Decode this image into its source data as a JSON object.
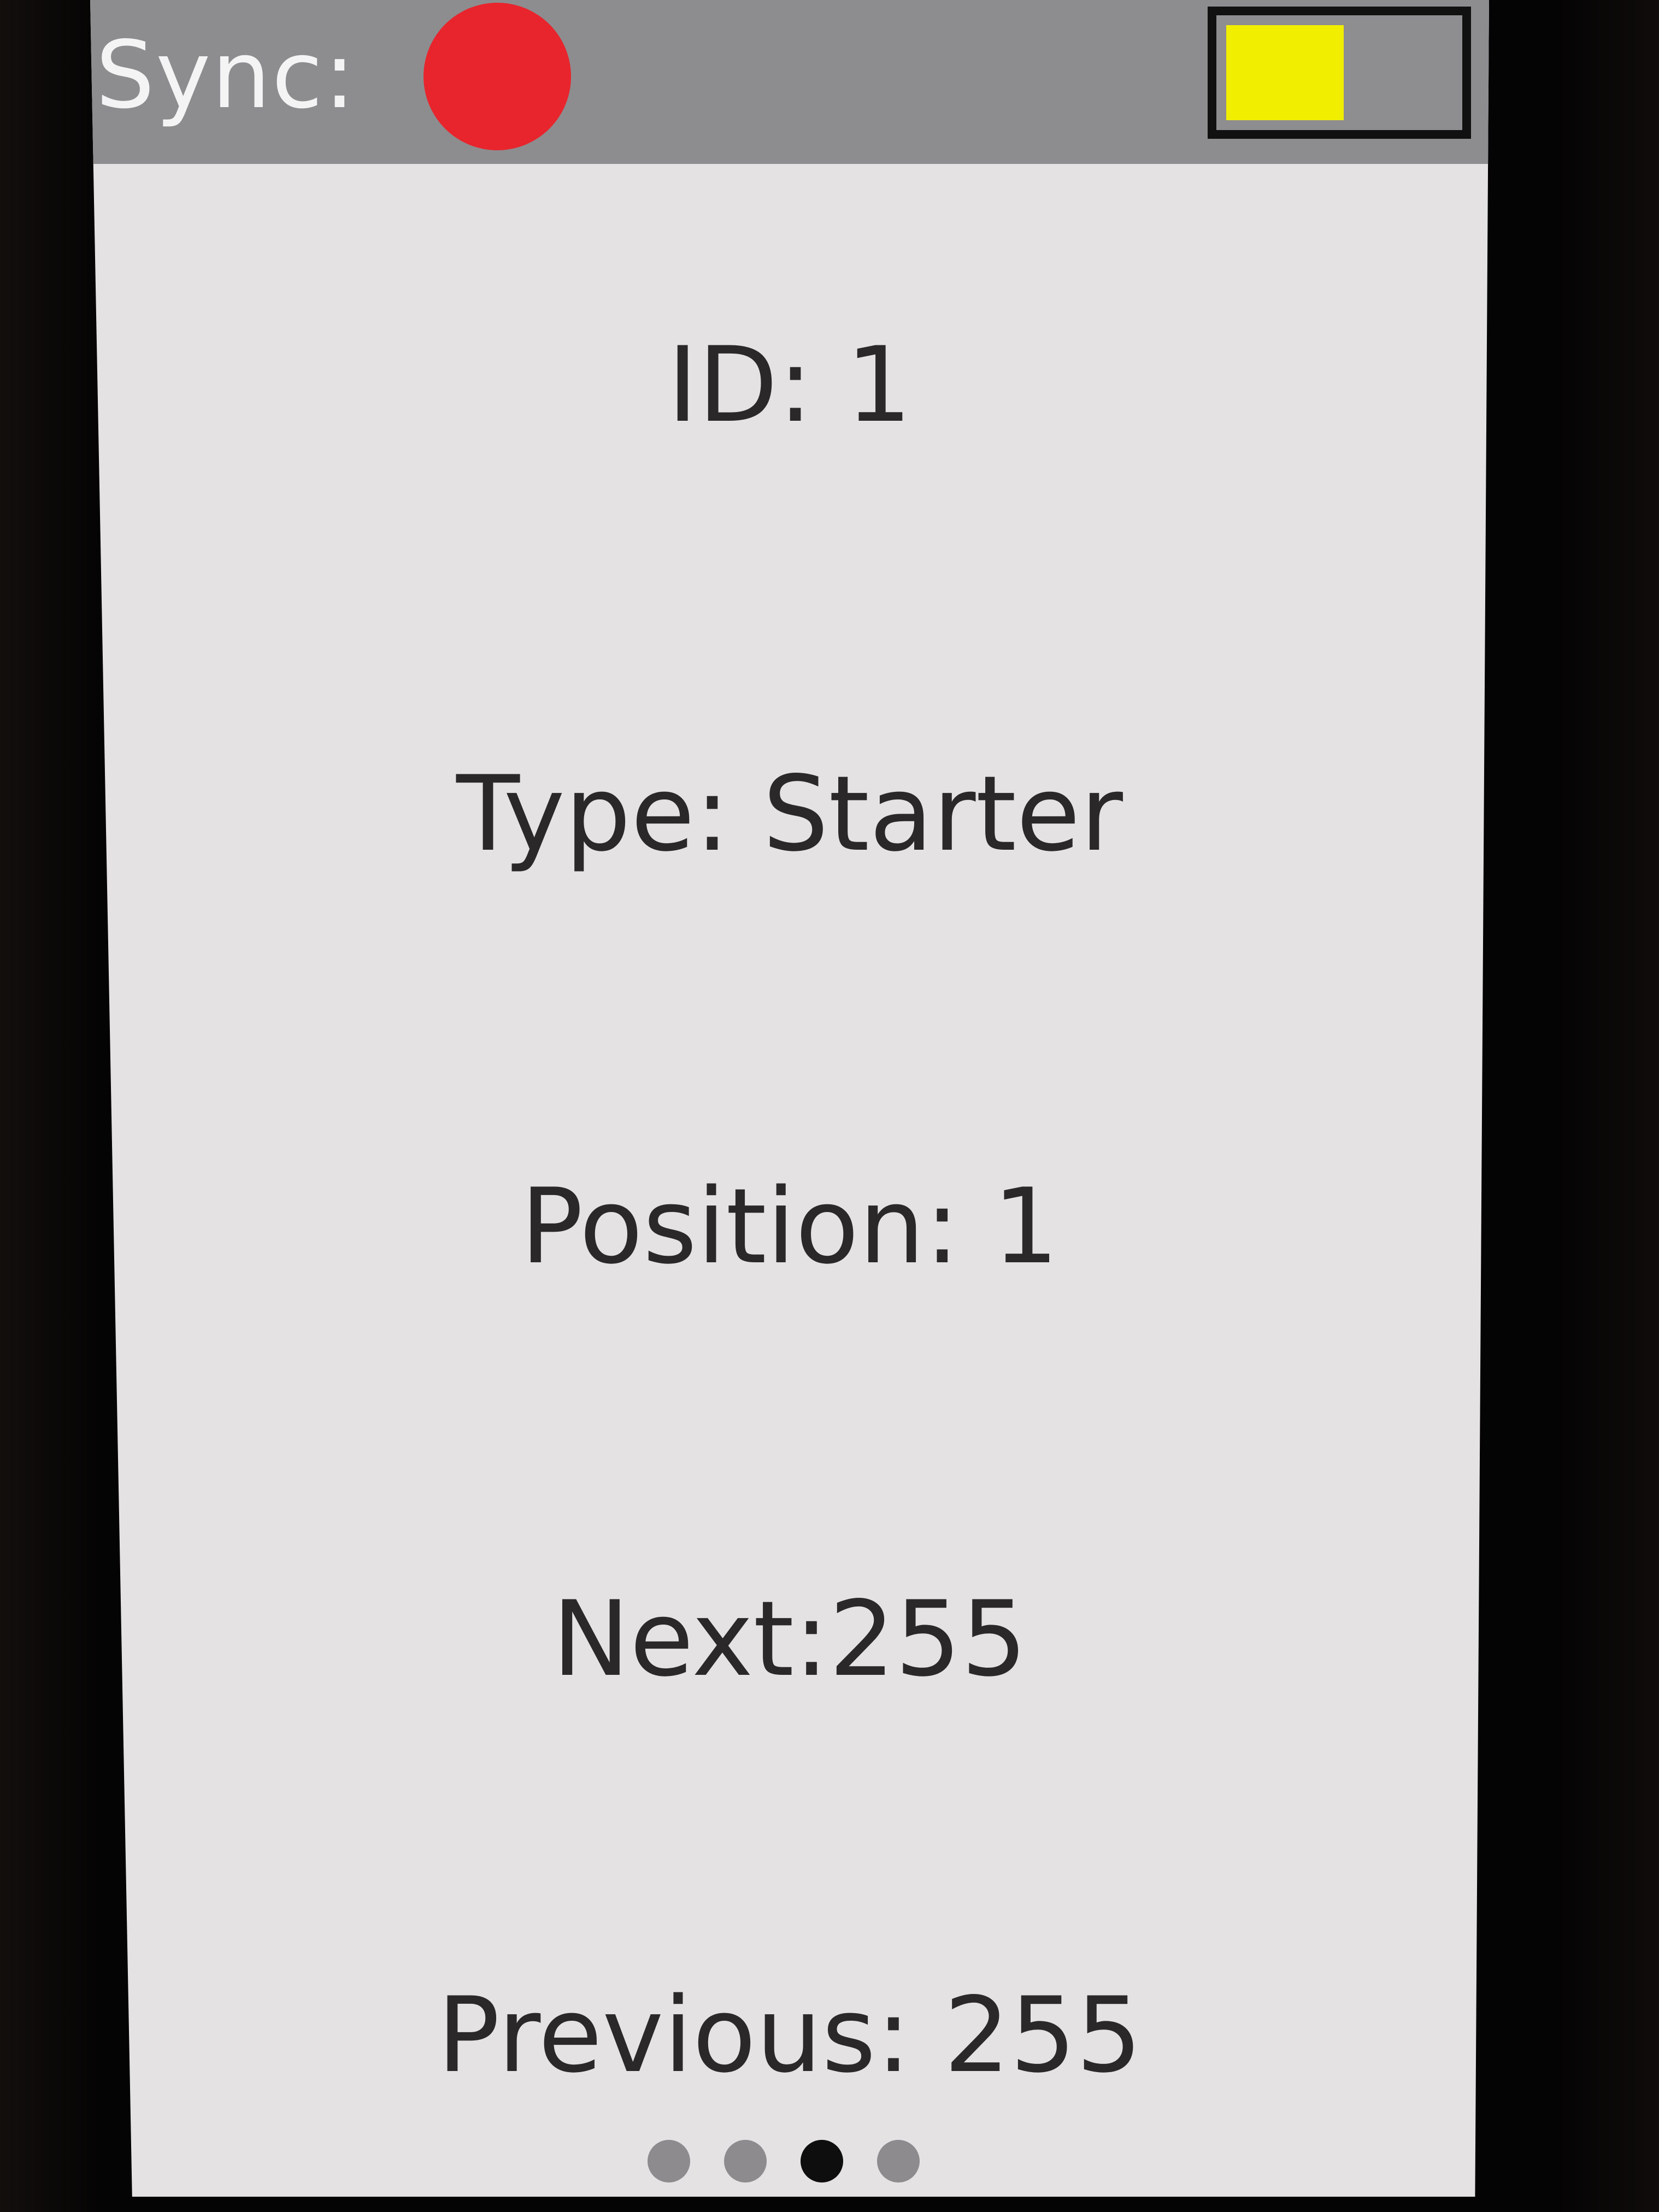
{
  "status_bar": {
    "sync_label": "Sync:",
    "sync_status_color": "#e8252c",
    "battery_level": 0.52,
    "battery_color": "#f1ee00"
  },
  "fields": {
    "id": "ID: 1",
    "type": "Type: Starter",
    "position": "Position: 1",
    "next": "Next:255",
    "previous": "Previous: 255"
  },
  "pager": {
    "page_count": 4,
    "active_index": 2
  }
}
